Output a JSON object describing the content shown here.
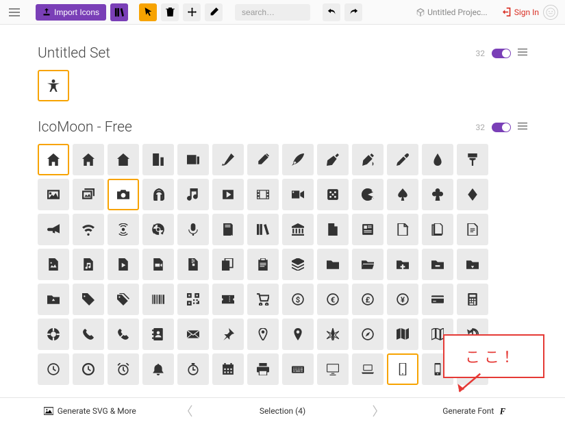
{
  "topbar": {
    "import_label": "Import Icons",
    "search_placeholder": "search…",
    "project_label": "Untitled Projec...",
    "signin_label": "Sign In"
  },
  "sets": [
    {
      "title": "Untitled Set",
      "count": "32",
      "icons": [
        {
          "name": "accessibility-icon",
          "svg": "accessibility",
          "selected": true
        }
      ]
    },
    {
      "title": "IcoMoon - Free",
      "count": "32",
      "icons": [
        {
          "name": "home-icon",
          "svg": "home",
          "selected": true
        },
        {
          "name": "home2-icon",
          "svg": "home"
        },
        {
          "name": "home3-icon",
          "svg": "home3"
        },
        {
          "name": "office-icon",
          "svg": "office"
        },
        {
          "name": "newspaper-icon",
          "svg": "newspaper"
        },
        {
          "name": "pencil-icon",
          "svg": "pencil"
        },
        {
          "name": "pencil2-icon",
          "svg": "pencil2"
        },
        {
          "name": "quill-icon",
          "svg": "quill"
        },
        {
          "name": "pen-icon",
          "svg": "pen"
        },
        {
          "name": "blog-icon",
          "svg": "blog"
        },
        {
          "name": "eyedropper-icon",
          "svg": "eyedropper"
        },
        {
          "name": "droplet-icon",
          "svg": "droplet"
        },
        {
          "name": "paint-format-icon",
          "svg": "paint"
        },
        {
          "name": "image-icon",
          "svg": "image"
        },
        {
          "name": "images-icon",
          "svg": "images"
        },
        {
          "name": "camera-icon",
          "svg": "camera",
          "selected": true
        },
        {
          "name": "headphones-icon",
          "svg": "headphones"
        },
        {
          "name": "music-icon",
          "svg": "music"
        },
        {
          "name": "play-icon",
          "svg": "play"
        },
        {
          "name": "film-icon",
          "svg": "film"
        },
        {
          "name": "video-camera-icon",
          "svg": "videocam"
        },
        {
          "name": "dice-icon",
          "svg": "dice"
        },
        {
          "name": "pacman-icon",
          "svg": "pacman"
        },
        {
          "name": "spades-icon",
          "svg": "spades"
        },
        {
          "name": "clubs-icon",
          "svg": "clubs"
        },
        {
          "name": "diamonds-icon",
          "svg": "diamonds"
        },
        {
          "name": "bullhorn-icon",
          "svg": "bullhorn"
        },
        {
          "name": "connection-icon",
          "svg": "wifi"
        },
        {
          "name": "podcast-icon",
          "svg": "podcast"
        },
        {
          "name": "feed-icon",
          "svg": "feed"
        },
        {
          "name": "mic-icon",
          "svg": "mic"
        },
        {
          "name": "book-icon",
          "svg": "book"
        },
        {
          "name": "books-icon",
          "svg": "books"
        },
        {
          "name": "library-icon",
          "svg": "library"
        },
        {
          "name": "file-text-icon",
          "svg": "filetext"
        },
        {
          "name": "profile-icon",
          "svg": "profile"
        },
        {
          "name": "file-empty-icon",
          "svg": "file"
        },
        {
          "name": "files-empty-icon",
          "svg": "files"
        },
        {
          "name": "file-text2-icon",
          "svg": "filetext2"
        },
        {
          "name": "file-picture-icon",
          "svg": "filepic"
        },
        {
          "name": "file-music-icon",
          "svg": "filemus"
        },
        {
          "name": "file-play-icon",
          "svg": "fileplay"
        },
        {
          "name": "file-video-icon",
          "svg": "filevid"
        },
        {
          "name": "file-zip-icon",
          "svg": "filezip"
        },
        {
          "name": "copy-icon",
          "svg": "copy"
        },
        {
          "name": "paste-icon",
          "svg": "paste"
        },
        {
          "name": "stack-icon",
          "svg": "stack"
        },
        {
          "name": "folder-icon",
          "svg": "folder"
        },
        {
          "name": "folder-open-icon",
          "svg": "folderopen"
        },
        {
          "name": "folder-plus-icon",
          "svg": "folderplus"
        },
        {
          "name": "folder-minus-icon",
          "svg": "folderminus"
        },
        {
          "name": "folder-download-icon",
          "svg": "folderdl"
        },
        {
          "name": "folder-upload-icon",
          "svg": "folderul"
        },
        {
          "name": "price-tag-icon",
          "svg": "tag"
        },
        {
          "name": "price-tags-icon",
          "svg": "tags"
        },
        {
          "name": "barcode-icon",
          "svg": "barcode"
        },
        {
          "name": "qrcode-icon",
          "svg": "qrcode"
        },
        {
          "name": "ticket-icon",
          "svg": "ticket"
        },
        {
          "name": "cart-icon",
          "svg": "cart"
        },
        {
          "name": "coin-dollar-icon",
          "svg": "coindollar"
        },
        {
          "name": "coin-euro-icon",
          "svg": "coineuro"
        },
        {
          "name": "coin-pound-icon",
          "svg": "coinpound"
        },
        {
          "name": "coin-yen-icon",
          "svg": "coinyen"
        },
        {
          "name": "credit-card-icon",
          "svg": "creditcard"
        },
        {
          "name": "calculator-icon",
          "svg": "calculator"
        },
        {
          "name": "lifebuoy-icon",
          "svg": "lifebuoy"
        },
        {
          "name": "phone-icon",
          "svg": "phone"
        },
        {
          "name": "phone-hang-up-icon",
          "svg": "phonehang"
        },
        {
          "name": "address-book-icon",
          "svg": "address"
        },
        {
          "name": "envelop-icon",
          "svg": "envelop"
        },
        {
          "name": "pushpin-icon",
          "svg": "pushpin"
        },
        {
          "name": "location-icon",
          "svg": "location"
        },
        {
          "name": "location2-icon",
          "svg": "location2"
        },
        {
          "name": "compass-icon",
          "svg": "compass"
        },
        {
          "name": "compass2-icon",
          "svg": "compass2"
        },
        {
          "name": "map-icon",
          "svg": "map"
        },
        {
          "name": "map2-icon",
          "svg": "map2"
        },
        {
          "name": "history-icon",
          "svg": "history"
        },
        {
          "name": "clock-icon",
          "svg": "clock"
        },
        {
          "name": "clock2-icon",
          "svg": "clock2"
        },
        {
          "name": "alarm-icon",
          "svg": "alarm"
        },
        {
          "name": "bell-icon",
          "svg": "bell"
        },
        {
          "name": "stopwatch-icon",
          "svg": "stopwatch"
        },
        {
          "name": "calendar-icon",
          "svg": "calendar"
        },
        {
          "name": "printer-icon",
          "svg": "printer"
        },
        {
          "name": "keyboard-icon",
          "svg": "keyboard"
        },
        {
          "name": "display-icon",
          "svg": "display"
        },
        {
          "name": "laptop-icon",
          "svg": "laptop"
        },
        {
          "name": "mobile-icon",
          "svg": "mobile",
          "selected": true
        },
        {
          "name": "mobile2-icon",
          "svg": "mobile2"
        },
        {
          "name": "tablet-icon",
          "svg": "tablet"
        }
      ]
    }
  ],
  "bottombar": {
    "svg_label": "Generate SVG & More",
    "selection_label": "Selection (4)",
    "font_label": "Generate Font"
  },
  "annotation": {
    "label": "ここ！"
  }
}
